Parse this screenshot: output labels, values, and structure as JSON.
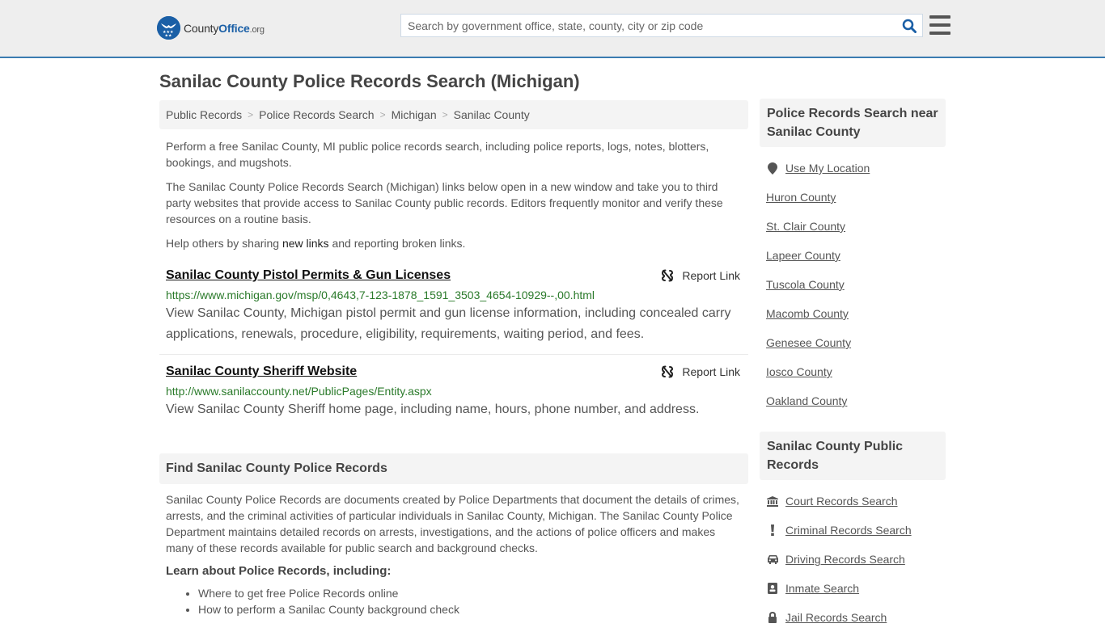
{
  "header": {
    "logo": {
      "name_part1": "County",
      "name_part2": "Office",
      "tld": ".org"
    },
    "search": {
      "placeholder": "Search by government office, state, county, city or zip code",
      "value": ""
    },
    "icons": {
      "search": "search-icon",
      "menu": "hamburger-menu-icon"
    }
  },
  "page": {
    "title": "Sanilac County Police Records Search (Michigan)"
  },
  "breadcrumb": [
    {
      "label": "Public Records"
    },
    {
      "label": "Police Records Search"
    },
    {
      "label": "Michigan"
    },
    {
      "label": "Sanilac County"
    }
  ],
  "breadcrumb_separator": ">",
  "intro": {
    "p1": "Perform a free Sanilac County, MI public police records search, including police reports, logs, notes, blotters, bookings, and mugshots.",
    "p2": "The Sanilac County Police Records Search (Michigan) links below open in a new window and take you to third party websites that provide access to Sanilac County public records. Editors frequently monitor and verify these resources on a routine basis.",
    "p3_before": "Help others by sharing ",
    "p3_link": "new links",
    "p3_after": " and reporting broken links."
  },
  "links": [
    {
      "title": "Sanilac County Pistol Permits & Gun Licenses",
      "url": "https://www.michigan.gov/msp/0,4643,7-123-1878_1591_3503_4654-10929--,00.html",
      "description": "View Sanilac County, Michigan pistol permit and gun license information, including concealed carry applications, renewals, procedure, eligibility, requirements, waiting period, and fees.",
      "report_label": "Report Link"
    },
    {
      "title": "Sanilac County Sheriff Website",
      "url": "http://www.sanilaccounty.net/PublicPages/Entity.aspx",
      "description": "View Sanilac County Sheriff home page, including name, hours, phone number, and address.",
      "report_label": "Report Link"
    }
  ],
  "find_section": {
    "heading": "Find Sanilac County Police Records",
    "body": "Sanilac County Police Records are documents created by Police Departments that document the details of crimes, arrests, and the criminal activities of particular individuals in Sanilac County, Michigan. The Sanilac County Police Department maintains detailed records on arrests, investigations, and the actions of police officers and makes many of these records available for public search and background checks.",
    "learn_heading": "Learn about Police Records, including:",
    "learn_items": [
      "Where to get free Police Records online",
      "How to perform a Sanilac County background check"
    ]
  },
  "sidebar": {
    "near": {
      "heading": "Police Records Search near Sanilac County",
      "use_location": "Use My Location",
      "counties": [
        "Huron County",
        "St. Clair County",
        "Lapeer County",
        "Tuscola County",
        "Macomb County",
        "Genesee County",
        "Iosco County",
        "Oakland County"
      ]
    },
    "public_records": {
      "heading": "Sanilac County Public Records",
      "items": [
        {
          "label": "Court Records Search",
          "icon": "courthouse-icon"
        },
        {
          "label": "Criminal Records Search",
          "icon": "exclamation-icon"
        },
        {
          "label": "Driving Records Search",
          "icon": "car-icon"
        },
        {
          "label": "Inmate Search",
          "icon": "id-badge-icon"
        },
        {
          "label": "Jail Records Search",
          "icon": "lock-icon"
        }
      ]
    }
  },
  "colors": {
    "header_bg": "#eeeeee",
    "header_border": "#3a7bb0",
    "brand_blue": "#1a5fa6",
    "url_green": "#2a7a2a",
    "panel_gray": "#f4f4f4"
  }
}
